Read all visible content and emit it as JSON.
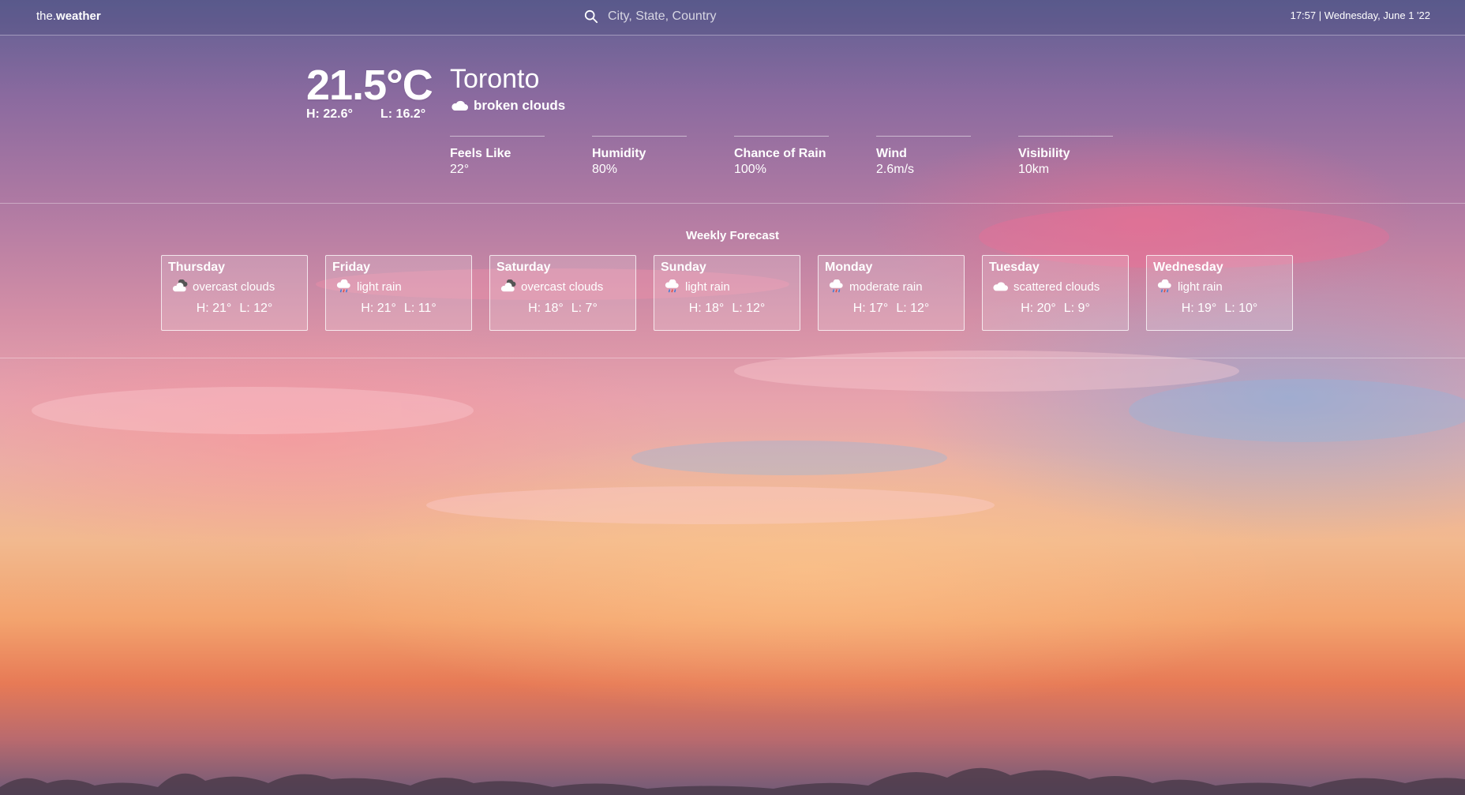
{
  "header": {
    "brand_prefix": "the.",
    "brand_name": "weather",
    "search_placeholder": "City, State, Country",
    "clock": "17:57 | Wednesday, June 1 '22"
  },
  "current": {
    "temperature": "21.5°C",
    "high": "H: 22.6°",
    "low": "L: 16.2°",
    "city": "Toronto",
    "condition": "broken clouds",
    "condition_icon": "cloud-icon"
  },
  "stats": [
    {
      "label": "Feels Like",
      "value": "22°"
    },
    {
      "label": "Humidity",
      "value": "80%"
    },
    {
      "label": "Chance of Rain",
      "value": "100%"
    },
    {
      "label": "Wind",
      "value": "2.6m/s"
    },
    {
      "label": "Visibility",
      "value": "10km"
    }
  ],
  "weekly": {
    "title": "Weekly Forecast",
    "days": [
      {
        "day": "Thursday",
        "desc": "overcast clouds",
        "icon": "overcast-cloud-icon",
        "high": "H: 21°",
        "low": "L: 12°"
      },
      {
        "day": "Friday",
        "desc": "light rain",
        "icon": "rain-cloud-icon",
        "high": "H: 21°",
        "low": "L: 11°"
      },
      {
        "day": "Saturday",
        "desc": "overcast clouds",
        "icon": "overcast-cloud-icon",
        "high": "H: 18°",
        "low": "L: 7°"
      },
      {
        "day": "Sunday",
        "desc": "light rain",
        "icon": "rain-cloud-icon",
        "high": "H: 18°",
        "low": "L: 12°"
      },
      {
        "day": "Monday",
        "desc": "moderate rain",
        "icon": "rain-cloud-icon",
        "high": "H: 17°",
        "low": "L: 12°"
      },
      {
        "day": "Tuesday",
        "desc": "scattered clouds",
        "icon": "cloud-icon",
        "high": "H: 20°",
        "low": "L: 9°"
      },
      {
        "day": "Wednesday",
        "desc": "light rain",
        "icon": "rain-cloud-icon",
        "high": "H: 19°",
        "low": "L: 10°"
      }
    ]
  }
}
